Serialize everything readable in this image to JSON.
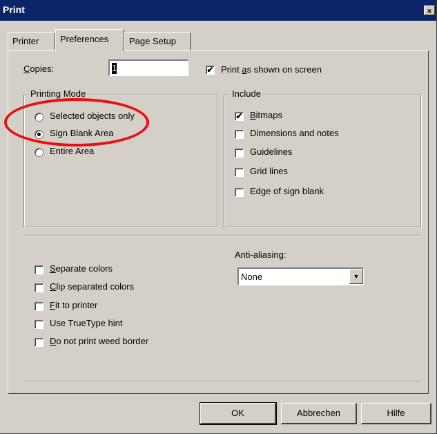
{
  "window": {
    "title": "Print",
    "close": "×"
  },
  "tabs": [
    {
      "label": "Printer"
    },
    {
      "label": "Preferences"
    },
    {
      "label": "Page Setup"
    }
  ],
  "copies": {
    "label": "Copies:",
    "value": "1"
  },
  "print_as_shown": {
    "label_pre": "Print ",
    "label_u": "a",
    "label_post": "s shown on screen",
    "checked": true,
    "mark": "✔"
  },
  "printing_mode": {
    "title": "Printing Mode",
    "options": [
      {
        "label": "Selected objects only",
        "selected": false
      },
      {
        "label": "Sign Blank Area",
        "selected": true
      },
      {
        "label": "Entire Area",
        "selected": false
      }
    ]
  },
  "include": {
    "title": "Include",
    "items": [
      {
        "label_u": "B",
        "label_post": "itmaps",
        "checked": true,
        "mark": "✔"
      },
      {
        "label_u": "",
        "label_post": "Dimensions and notes",
        "checked": false,
        "mark": ""
      },
      {
        "label_u": "",
        "label_post": "Guidelines",
        "checked": false,
        "mark": ""
      },
      {
        "label_u": "",
        "label_post": "Grid lines",
        "checked": false,
        "mark": ""
      },
      {
        "label_u": "",
        "label_post": "Edge of sign blank",
        "checked": false,
        "mark": ""
      }
    ]
  },
  "options": [
    {
      "label_u": "S",
      "label_post": "eparate colors",
      "checked": false
    },
    {
      "label_u": "C",
      "label_post": "lip separated colors",
      "checked": false
    },
    {
      "label_u": "F",
      "label_post": "it to printer",
      "checked": false
    },
    {
      "label_u": "",
      "label_post": "Use TrueType hint",
      "checked": false
    },
    {
      "label_u": "D",
      "label_post": "o not print weed border",
      "checked": false
    }
  ],
  "anti_aliasing": {
    "label": "Anti-aliasing:",
    "value": "None",
    "arrow": "▼"
  },
  "buttons": {
    "ok": "OK",
    "cancel": "Abbrechen",
    "help": "Hilfe"
  },
  "colors": {
    "title_bar": "#0a246a",
    "dialog": "#d4d0c8",
    "annotation": "#e81010"
  }
}
